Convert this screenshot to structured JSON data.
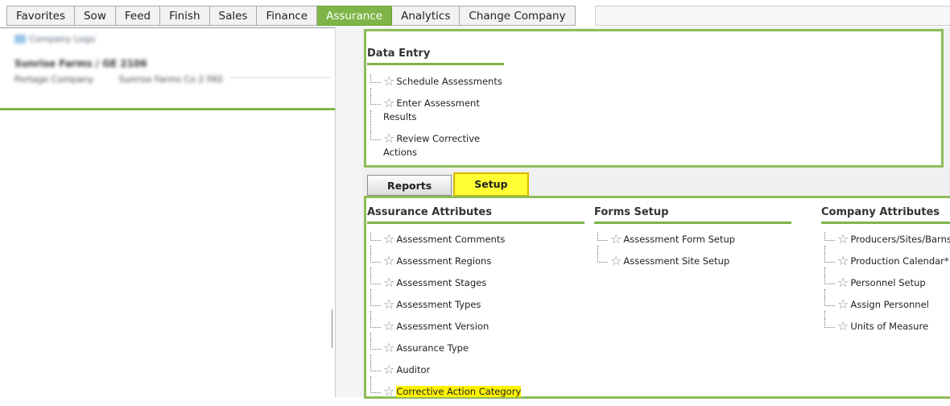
{
  "nav": {
    "tabs": [
      "Favorites",
      "Sow",
      "Feed",
      "Finish",
      "Sales",
      "Finance",
      "Assurance",
      "Analytics",
      "Change Company"
    ],
    "active_index": 6
  },
  "left_panel": {
    "logo_alt": "Company Logo",
    "company_name": "Sunrise Farms / GE 2106",
    "group_label": "Portage Company",
    "group_value": "Sunrise Farms Co 2 FAS"
  },
  "data_entry": {
    "title": "Data Entry",
    "items": [
      "Schedule Assessments",
      "Enter Assessment Results",
      "Review Corrective Actions"
    ]
  },
  "subtabs": {
    "reports": "Reports",
    "setup": "Setup",
    "active": "setup"
  },
  "sections": {
    "assurance_attributes": {
      "title": "Assurance Attributes",
      "items": [
        "Assessment Comments",
        "Assessment Regions",
        "Assessment Stages",
        "Assessment Types",
        "Assessment Version",
        "Assurance Type",
        "Auditor",
        "Corrective Action Category"
      ],
      "highlighted": "Corrective Action Category"
    },
    "forms_setup": {
      "title": "Forms Setup",
      "items": [
        "Assessment Form Setup",
        "Assessment Site Setup"
      ]
    },
    "company_attributes": {
      "title": "Company Attributes",
      "items": [
        "Producers/Sites/Barns*",
        "Production Calendar*",
        "Personnel Setup",
        "Assign Personnel",
        "Units of Measure"
      ]
    }
  },
  "icons": {
    "favorite": "star-outline-icon",
    "star_glyph": "☆"
  },
  "colors": {
    "accent": "#7eb548",
    "highlight": "#fff200",
    "panel_border": "#8dbd5b"
  }
}
